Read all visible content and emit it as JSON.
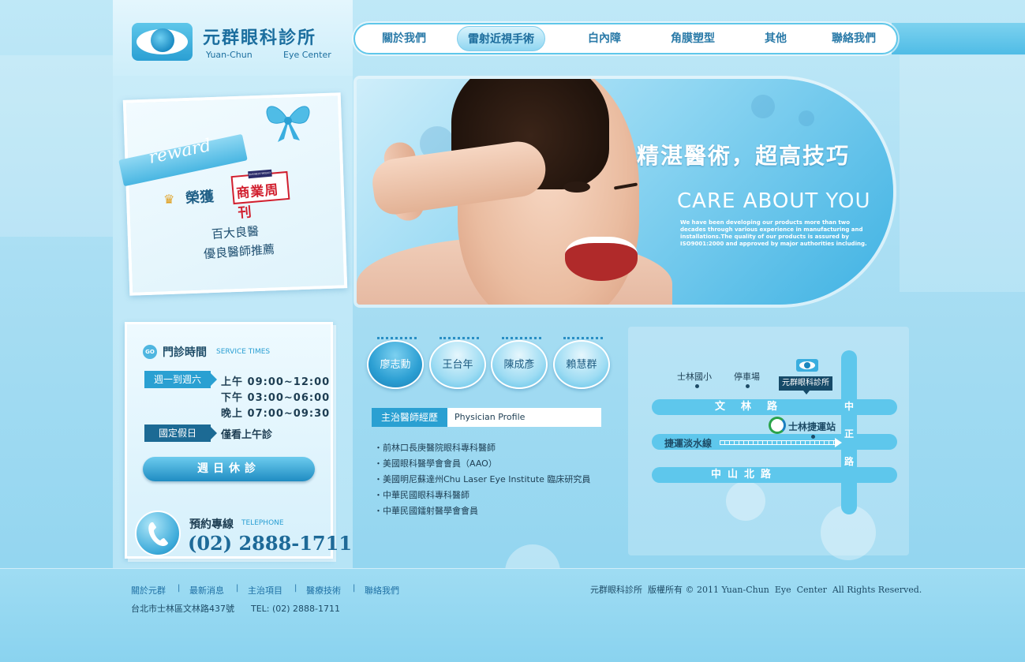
{
  "logo": {
    "title": "元群眼科診所",
    "sub_left": "Yuan-Chun",
    "sub_right": "Eye  Center"
  },
  "nav": {
    "items": [
      {
        "label": "關於我們"
      },
      {
        "label": "雷射近視手術",
        "active": true
      },
      {
        "label": "白內障"
      },
      {
        "label": "角膜塑型"
      },
      {
        "label": "其他"
      },
      {
        "label": "聯絡我們"
      }
    ]
  },
  "reward": {
    "badge_word": "reward",
    "honor": "榮獲",
    "magazine_top": "BUSINESS WEEKLY",
    "magazine": "商業周刊",
    "line1": "百大良醫",
    "line2": "優良醫師推薦"
  },
  "service": {
    "go": "GO",
    "title": "門診時間",
    "subtitle": "SERVICE TIMES",
    "weekday_tag": "週一到週六",
    "times": [
      "上午  09:00~12:00",
      "下午  03:00~06:00",
      "晚上  07:00~09:30"
    ],
    "holiday_tag": "國定假日",
    "holiday_text": "僅看上午診",
    "sunday": "週日休診"
  },
  "phone": {
    "label": "預約專線",
    "sub": "TELEPHONE",
    "number": "(02) 2888-1711"
  },
  "hero": {
    "title": "精湛醫術，超高技巧",
    "care": "CARE ABOUT",
    "you": "YOU",
    "desc": "We have been developing our products more than two decades through various experience in manufacturing and installations.The quality of our products is assured by ISO9001:2000 and approved by major authorities including."
  },
  "doctors": {
    "names": [
      "廖志勳",
      "王台年",
      "陳成彥",
      "賴慧群"
    ],
    "active_index": 0
  },
  "profile": {
    "tab": "主治醫師經歷",
    "tab_en": "Physician Profile",
    "items": [
      "・前林口長庚醫院眼科專科醫師",
      "・美國眼科醫學會會員（AAO）",
      "・美國明尼蘇達州Chu Laser Eye Institute 臨床研究員",
      "・中華民國眼科專科醫師",
      "・中華民國鐳射醫學會會員"
    ]
  },
  "map": {
    "school": "士林國小",
    "parking": "停車場",
    "clinic": "元群眼科診所",
    "road_wenlin": "文林路",
    "road_zhongzheng": [
      "中",
      "正",
      "路"
    ],
    "mrt_line": "捷運淡水線",
    "mrt_station": "士林捷運站",
    "road_zhongshan": "中山北路"
  },
  "footer": {
    "links": [
      "關於元群",
      "最新消息",
      "主治項目",
      "醫療技術",
      "聯絡我們"
    ],
    "separator": "|",
    "address": "台北市士林區文林路437號      TEL: (02) 2888-1711",
    "copyright": "元群眼科診所  版權所有 © 2011 Yuan-Chun  Eye  Center  All Rights Reserved."
  },
  "colors": {
    "primary": "#2aa0d2",
    "dark": "#1c6a94",
    "text": "#1d3d52",
    "accent_red": "#d11f2e"
  }
}
